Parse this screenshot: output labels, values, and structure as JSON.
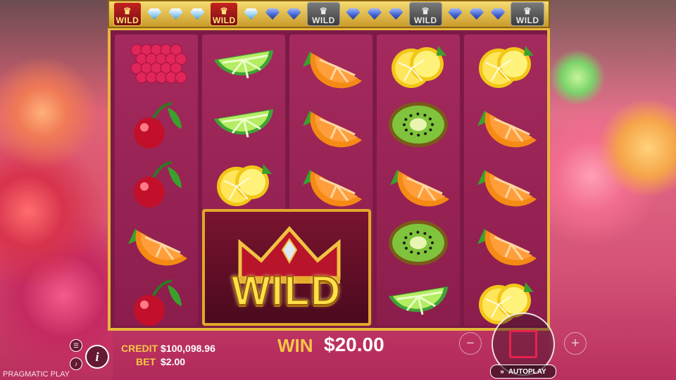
{
  "top_bar": {
    "items": [
      {
        "kind": "wild-gold",
        "label": "WILD"
      },
      {
        "kind": "gem-light"
      },
      {
        "kind": "gem-light"
      },
      {
        "kind": "gem-light"
      },
      {
        "kind": "wild-gold",
        "label": "WILD"
      },
      {
        "kind": "gem-light"
      },
      {
        "kind": "gem-dark"
      },
      {
        "kind": "gem-dark"
      },
      {
        "kind": "wild-gray",
        "label": "WILD"
      },
      {
        "kind": "gem-dark"
      },
      {
        "kind": "gem-dark"
      },
      {
        "kind": "gem-dark"
      },
      {
        "kind": "wild-gray",
        "label": "WILD"
      },
      {
        "kind": "gem-dark"
      },
      {
        "kind": "gem-dark"
      },
      {
        "kind": "gem-dark"
      },
      {
        "kind": "wild-gray",
        "label": "WILD"
      }
    ]
  },
  "reels": [
    [
      "raspberry",
      "cherry",
      "cherry",
      "orange",
      "cherry"
    ],
    [
      "lime",
      "lime",
      "lemon",
      "wild",
      "wild"
    ],
    [
      "orange",
      "orange",
      "orange",
      "wild",
      "wild"
    ],
    [
      "lemon",
      "kiwi",
      "orange",
      "kiwi",
      "lime"
    ],
    [
      "lemon",
      "orange",
      "orange",
      "orange",
      "lemon"
    ]
  ],
  "big_wild": {
    "label": "WILD"
  },
  "credit": {
    "label": "CREDIT",
    "value": "$100,098.96"
  },
  "bet": {
    "label": "BET",
    "value": "$2.00"
  },
  "win": {
    "label": "WIN",
    "value": "$20.00"
  },
  "controls": {
    "minus": "−",
    "plus": "+",
    "autoplay": "AUTOPLAY",
    "info": "i",
    "menu": "☰",
    "sound": "🔊"
  },
  "brand": "PRAGMATIC PLAY",
  "colors": {
    "gold": "#f6c745",
    "frame": "#e6b83b",
    "spin_square": "#e9214f"
  }
}
